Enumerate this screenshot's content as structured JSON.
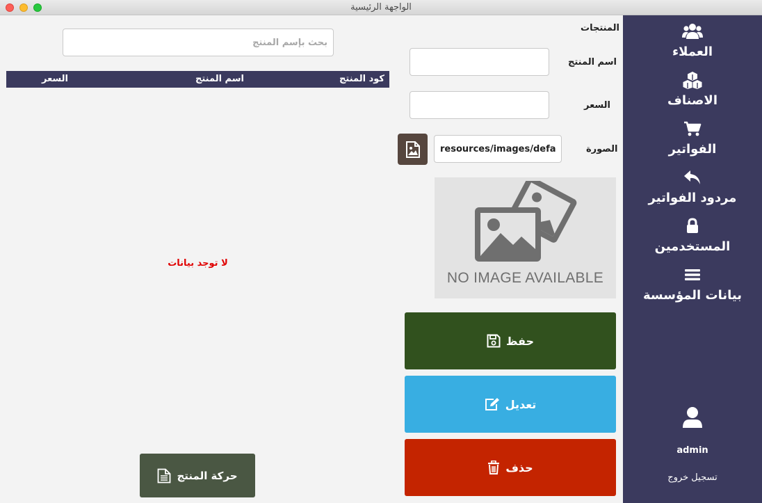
{
  "window": {
    "title": "الواجهة الرئيسية"
  },
  "sidebar": {
    "items": [
      {
        "label": "العملاء",
        "icon": "users-icon"
      },
      {
        "label": "الاصناف",
        "icon": "cubes-icon"
      },
      {
        "label": "الفواتير",
        "icon": "cart-icon"
      },
      {
        "label": "مردود الفواتير",
        "icon": "reply-icon"
      },
      {
        "label": "المستخدمين",
        "icon": "lock-icon"
      },
      {
        "label": "بيانات المؤسسة",
        "icon": "bars-icon"
      }
    ],
    "user": {
      "name": "admin",
      "icon": "user-icon"
    },
    "logout_label": "تسجيل خروج"
  },
  "form": {
    "section_title": "المنتجات",
    "product_name_label": "اسم المنتج",
    "product_name_value": "",
    "price_label": "السعر",
    "price_value": "",
    "image_label": "الصورة",
    "image_path": "resources/images/defaul",
    "no_image_text": "NO IMAGE AVAILABLE"
  },
  "actions": {
    "save_label": "حفظ",
    "edit_label": "تعديل",
    "delete_label": "حذف"
  },
  "table": {
    "search_placeholder": "بحث بإسم المنتج",
    "columns": [
      "كود المنتج",
      "اسم المنتج",
      "السعر"
    ],
    "rows": [],
    "empty_message": "لا توجد بيانات"
  },
  "product_movement_label": "حركة المنتج",
  "colors": {
    "sidebar": "#3b3a5e",
    "save": "#31511e",
    "edit": "#38aee2",
    "delete": "#c42400",
    "movement": "#4a5743",
    "empty_message": "#e00000"
  }
}
